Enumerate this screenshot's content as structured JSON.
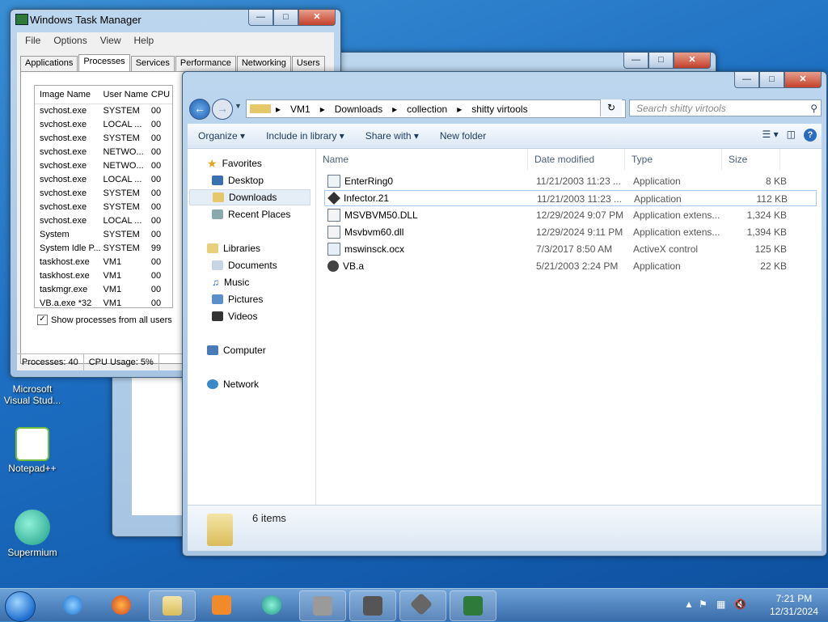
{
  "desktop": {
    "icons": [
      {
        "label": "Microsoft Visual Stud...",
        "color": "#7a4fbf"
      },
      {
        "label": "Notepad++",
        "color": "#6fbf3a"
      },
      {
        "label": "Supermium",
        "color": "#2bb59a"
      }
    ]
  },
  "task_manager": {
    "title": "Windows Task Manager",
    "menu": [
      "File",
      "Options",
      "View",
      "Help"
    ],
    "tabs": [
      "Applications",
      "Processes",
      "Services",
      "Performance",
      "Networking",
      "Users"
    ],
    "active_tab": "Processes",
    "columns": [
      "Image Name",
      "User Name",
      "CPU"
    ],
    "rows": [
      [
        "svchost.exe",
        "SYSTEM",
        "00"
      ],
      [
        "svchost.exe",
        "LOCAL ...",
        "00"
      ],
      [
        "svchost.exe",
        "SYSTEM",
        "00"
      ],
      [
        "svchost.exe",
        "NETWO...",
        "00"
      ],
      [
        "svchost.exe",
        "NETWO...",
        "00"
      ],
      [
        "svchost.exe",
        "LOCAL ...",
        "00"
      ],
      [
        "svchost.exe",
        "SYSTEM",
        "00"
      ],
      [
        "svchost.exe",
        "SYSTEM",
        "00"
      ],
      [
        "svchost.exe",
        "LOCAL ...",
        "00"
      ],
      [
        "System",
        "SYSTEM",
        "00"
      ],
      [
        "System Idle P...",
        "SYSTEM",
        "99"
      ],
      [
        "taskhost.exe",
        "VM1",
        "00"
      ],
      [
        "taskhost.exe",
        "VM1",
        "00"
      ],
      [
        "taskmgr.exe",
        "VM1",
        "00"
      ],
      [
        "VB.a.exe *32",
        "VM1",
        "00"
      ]
    ],
    "show_all_label": "Show processes from all users",
    "status_processes": "Processes: 40",
    "status_cpu": "CPU Usage: 5%"
  },
  "explorer": {
    "breadcrumb": [
      "VM1",
      "Downloads",
      "collection",
      "shitty virtools"
    ],
    "search_placeholder": "Search shitty virtools",
    "commands": [
      "Organize",
      "Include in library",
      "Share with",
      "New folder"
    ],
    "nav": {
      "favorites": "Favorites",
      "desktop": "Desktop",
      "downloads": "Downloads",
      "recent": "Recent Places",
      "libraries": "Libraries",
      "documents": "Documents",
      "music": "Music",
      "pictures": "Pictures",
      "videos": "Videos",
      "computer": "Computer",
      "network": "Network"
    },
    "columns": [
      "Name",
      "Date modified",
      "Type",
      "Size"
    ],
    "files": [
      {
        "name": "EnterRing0",
        "date": "11/21/2003 11:23 ...",
        "type": "Application",
        "size": "8 KB",
        "icon": "app-icon"
      },
      {
        "name": "Infector.21",
        "date": "11/21/2003 11:23 ...",
        "type": "Application",
        "size": "112 KB",
        "icon": "x-icon"
      },
      {
        "name": "MSVBVM50.DLL",
        "date": "12/29/2024 9:07 PM",
        "type": "Application extens...",
        "size": "1,324 KB",
        "icon": "dll-icon"
      },
      {
        "name": "Msvbvm60.dll",
        "date": "12/29/2024 9:11 PM",
        "type": "Application extens...",
        "size": "1,394 KB",
        "icon": "dll-icon"
      },
      {
        "name": "mswinsck.ocx",
        "date": "7/3/2017 8:50 AM",
        "type": "ActiveX control",
        "size": "125 KB",
        "icon": "ocx-icon"
      },
      {
        "name": "VB.a",
        "date": "5/21/2003 2:24 PM",
        "type": "Application",
        "size": "22 KB",
        "icon": "vb-icon"
      }
    ],
    "item_count": "6 items"
  },
  "taskbar": {
    "time": "7:21 PM",
    "date": "12/31/2024"
  }
}
